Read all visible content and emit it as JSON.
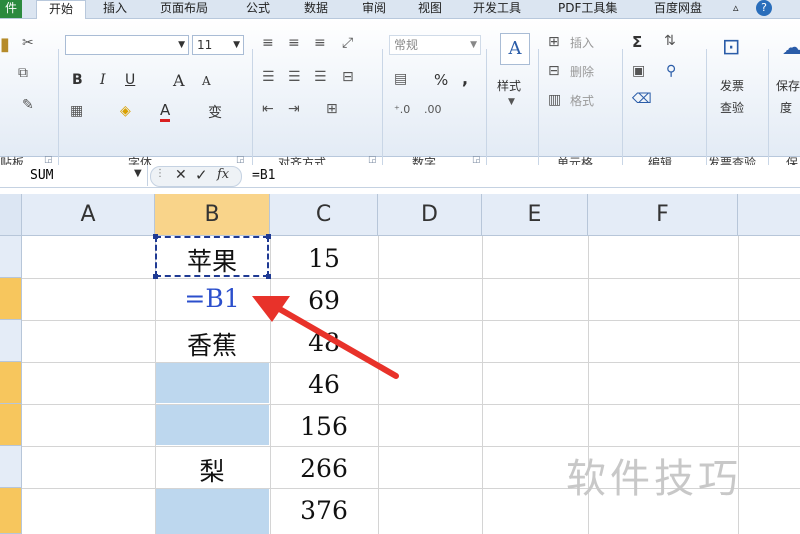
{
  "tabs": {
    "file": "件",
    "home": "开始",
    "insert": "插入",
    "layout": "页面布局",
    "formulas": "公式",
    "data": "数据",
    "review": "审阅",
    "view": "视图",
    "developer": "开发工具",
    "pdf": "PDF工具集",
    "baidu": "百度网盘"
  },
  "ribbon": {
    "clipboard_label": "贴板",
    "font_label": "字体",
    "font_size": "11",
    "bold": "B",
    "italic": "I",
    "underline": "U",
    "font_grow": "A",
    "font_shrink": "A",
    "font_color": "A",
    "phonetic": "变",
    "align_label": "对齐方式",
    "number_label": "数字",
    "number_format": "常规",
    "percent": "%",
    "comma": ",",
    "style_button": "样式",
    "cells_label": "单元格",
    "insert": "插入",
    "delete": "删除",
    "format": "格式",
    "edit_label": "编辑",
    "sigma": "Σ",
    "invoice_button_line1": "发票",
    "invoice_button_line2": "查验",
    "invoice_label": "发票查验",
    "save_button_line1": "保存",
    "save_button_line2": "度",
    "save_label": "保"
  },
  "formula_bar": {
    "name_box": "SUM",
    "cancel": "✕",
    "enter": "✓",
    "fx": "fx",
    "formula": "=B1"
  },
  "grid": {
    "columns": [
      "A",
      "B",
      "C",
      "D",
      "E",
      "F"
    ],
    "selected_column": "B",
    "colB": [
      "苹果",
      "=B1",
      "香蕉",
      "",
      "",
      "梨",
      ""
    ],
    "colC": [
      "15",
      "69",
      "48",
      "46",
      "156",
      "266",
      "376"
    ]
  },
  "colors": {
    "selection_fill": "#bdd7ee",
    "selected_header": "#f9d48a",
    "arrow": "#e8322a",
    "formula_ref": "#2b4fcc"
  },
  "watermark": "软件技巧"
}
